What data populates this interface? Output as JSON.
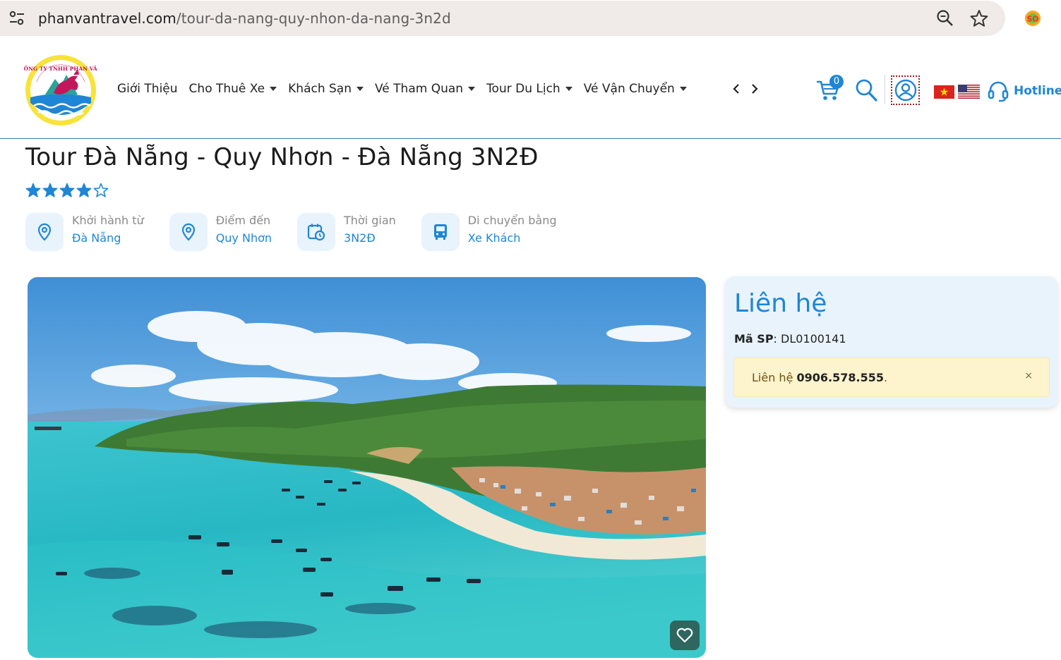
{
  "browser": {
    "url_host": "phanvantravel.com",
    "url_path": "/tour-da-nang-quy-nhon-da-nang-3n2d"
  },
  "header": {
    "nav": [
      {
        "label": "Giới Thiệu",
        "has_dropdown": false
      },
      {
        "label": "Cho Thuê Xe",
        "has_dropdown": true
      },
      {
        "label": "Khách Sạn",
        "has_dropdown": true
      },
      {
        "label": "Vé Tham Quan",
        "has_dropdown": true
      },
      {
        "label": "Tour Du Lịch",
        "has_dropdown": true
      },
      {
        "label": "Vé Vận Chuyển",
        "has_dropdown": true
      }
    ],
    "cart_count": "0",
    "hotline_label": "Hotline",
    "logo_text": "CÔNG TY TNHH PHAN VÂN"
  },
  "tour": {
    "title": "Tour Đà Nẵng - Quy Nhơn - Đà Nẵng 3N2Đ",
    "rating": 4,
    "rating_max": 5,
    "info": [
      {
        "label": "Khởi hành từ",
        "value": "Đà Nẵng",
        "icon": "map-pin-icon"
      },
      {
        "label": "Điểm đến",
        "value": "Quy Nhơn",
        "icon": "map-pin-icon"
      },
      {
        "label": "Thời gian",
        "value": "3N2Đ",
        "icon": "calendar-clock-icon"
      },
      {
        "label": "Di chuyển bằng",
        "value": "Xe Khách",
        "icon": "bus-icon"
      }
    ]
  },
  "contact": {
    "title": "Liên hệ",
    "sku_label": "Mã SP",
    "sku_value": ": DL0100141",
    "alert_prefix": "Liên hệ ",
    "alert_phone": "0906.578.555",
    "alert_suffix": ".",
    "close_symbol": "×"
  },
  "colors": {
    "accent": "#1f86d6",
    "card_bg": "#e8f3fc",
    "alert_bg": "#fdf3cd"
  }
}
